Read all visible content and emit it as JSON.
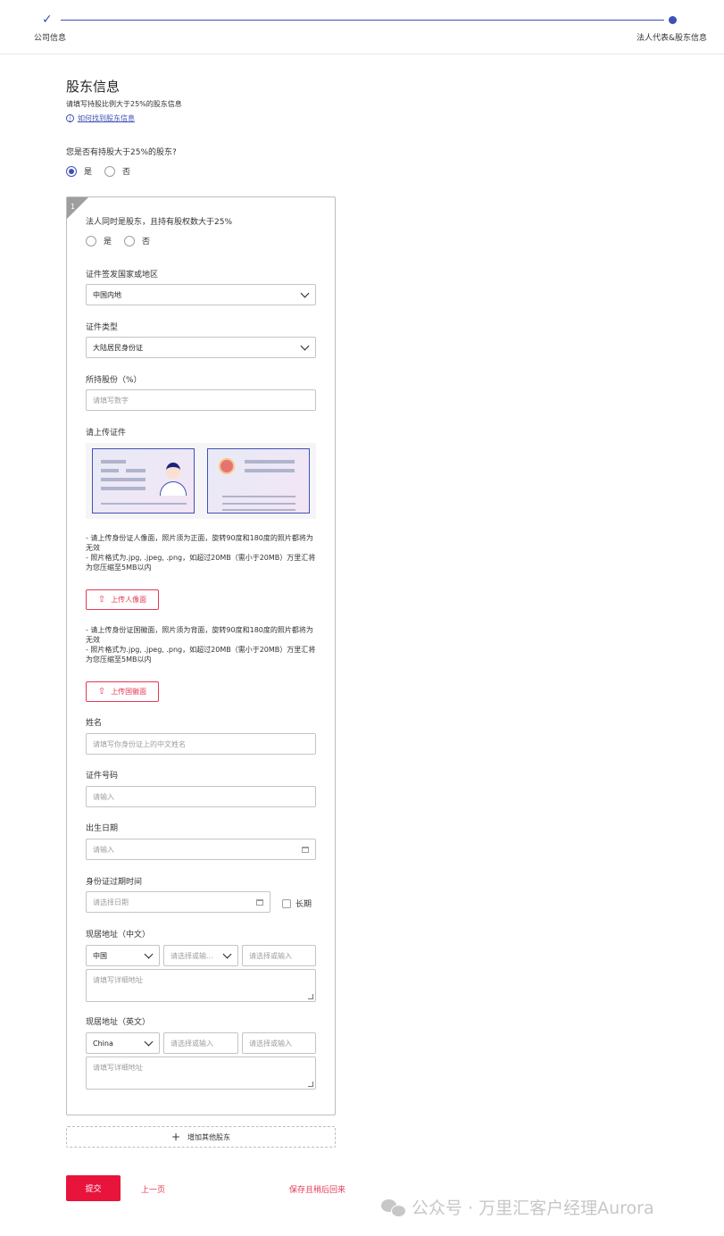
{
  "stepper": {
    "step1": "公司信息",
    "step2": "法人代表&股东信息"
  },
  "header": {
    "title": "股东信息",
    "subtitle": "请填写持股比例大于25%的股东信息",
    "help_link": "如何找到股东信息"
  },
  "q_major_shareholder": {
    "question": "您是否有持股大于25%的股东?",
    "yes": "是",
    "no": "否",
    "selected": "是"
  },
  "shareholder": {
    "index": "1",
    "q_legal_rep": {
      "question": "法人同时是股东，且持有股权数大于25%",
      "yes": "是",
      "no": "否"
    },
    "country": {
      "label": "证件签发国家或地区",
      "value": "中国内地"
    },
    "id_type": {
      "label": "证件类型",
      "value": "大陆居民身份证"
    },
    "share_pct": {
      "label": "所持股份（%）",
      "placeholder": "请填写数字"
    },
    "upload": {
      "label": "请上传证件",
      "front_note_1": "- 请上传身份证人像面，照片须为正面，旋转90度和180度的照片都将为无效",
      "front_note_2": "- 照片格式为.jpg, .jpeg, .png，如超过20MB（需小于20MB）万里汇将为您压缩至5MB以内",
      "front_button": "上传人像面",
      "back_note_1": "- 请上传身份证国徽面，照片须为背面，旋转90度和180度的照片都将为无效",
      "back_note_2": "- 照片格式为.jpg, .jpeg, .png，如超过20MB（需小于20MB）万里汇将为您压缩至5MB以内",
      "back_button": "上传国徽面"
    },
    "name": {
      "label": "姓名",
      "placeholder": "请填写你身份证上的中文姓名"
    },
    "id_number": {
      "label": "证件号码",
      "placeholder": "请输入"
    },
    "birth_date": {
      "label": "出生日期",
      "placeholder": "请输入"
    },
    "id_expiry": {
      "label": "身份证过期时间",
      "placeholder": "请选择日期",
      "long_term": "长期"
    },
    "address_cn": {
      "label": "现居地址（中文）",
      "country": "中国",
      "province_placeholder": "请选择或输...",
      "city_placeholder": "请选择或输入",
      "detail_placeholder": "请填写详细地址"
    },
    "address_en": {
      "label": "现居地址（英文）",
      "country": "China",
      "province_placeholder": "请选择或输入",
      "city_placeholder": "请选择或输入",
      "detail_placeholder": "请填写详细地址"
    }
  },
  "add_shareholder": "增加其他股东",
  "footer": {
    "submit": "提交",
    "prev": "上一页",
    "save_later": "保存且稍后回来"
  },
  "watermark": "公众号 · 万里汇客户经理Aurora",
  "colors": {
    "primary": "#3f51b5",
    "accent_red": "#e8143c"
  }
}
